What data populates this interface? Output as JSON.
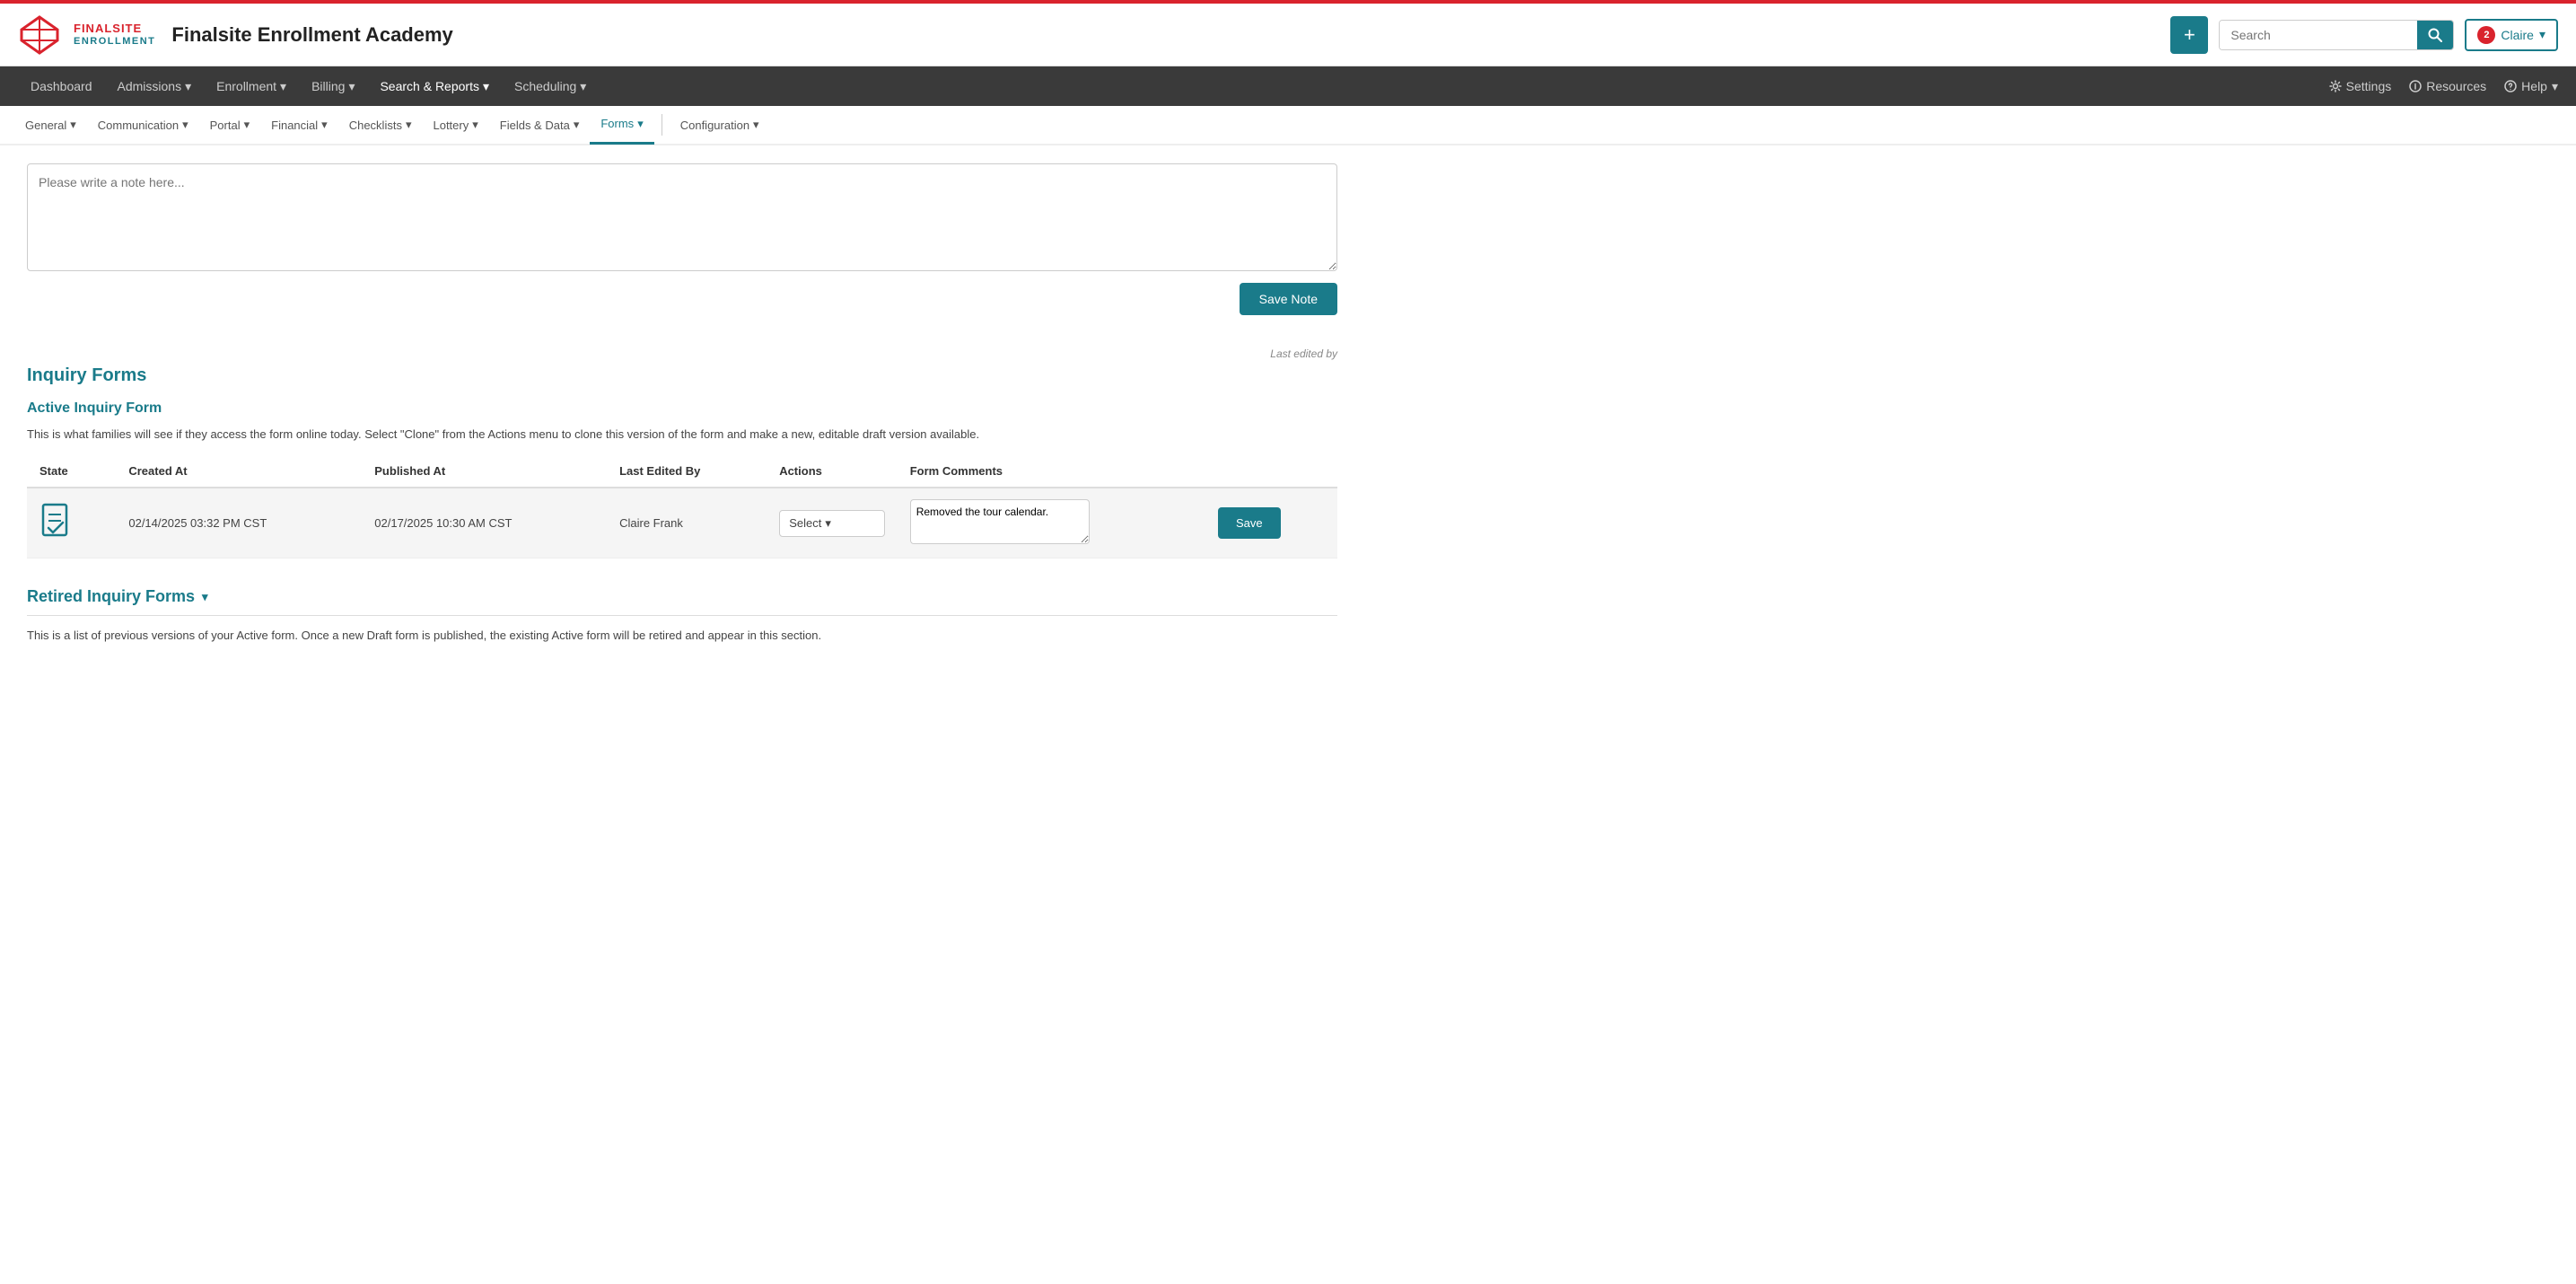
{
  "topbar": {
    "app_name": "Finalsite Enrollment Academy",
    "add_btn_label": "+",
    "search_placeholder": "Search",
    "notif_count": "2",
    "user_name": "Claire",
    "chevron": "▾"
  },
  "main_nav": {
    "items": [
      {
        "label": "Dashboard",
        "active": false
      },
      {
        "label": "Admissions",
        "active": false,
        "has_arrow": true
      },
      {
        "label": "Enrollment",
        "active": false,
        "has_arrow": true
      },
      {
        "label": "Billing",
        "active": false,
        "has_arrow": true
      },
      {
        "label": "Search & Reports",
        "active": false,
        "has_arrow": true
      },
      {
        "label": "Scheduling",
        "active": false,
        "has_arrow": true
      }
    ],
    "right_items": [
      {
        "icon": "gear-icon",
        "label": "Settings"
      },
      {
        "icon": "info-icon",
        "label": "Resources"
      },
      {
        "icon": "help-icon",
        "label": "Help",
        "has_arrow": true
      }
    ]
  },
  "sub_nav": {
    "items": [
      {
        "label": "General",
        "active": false,
        "has_arrow": true
      },
      {
        "label": "Communication",
        "active": false,
        "has_arrow": true
      },
      {
        "label": "Portal",
        "active": false,
        "has_arrow": true
      },
      {
        "label": "Financial",
        "active": false,
        "has_arrow": true
      },
      {
        "label": "Checklists",
        "active": false,
        "has_arrow": true
      },
      {
        "label": "Lottery",
        "active": false,
        "has_arrow": true
      },
      {
        "label": "Fields & Data",
        "active": false,
        "has_arrow": true
      },
      {
        "label": "Forms",
        "active": true,
        "has_arrow": true
      },
      {
        "label": "Configuration",
        "active": false,
        "has_arrow": true
      }
    ]
  },
  "note_area": {
    "placeholder": "Please write a note here...",
    "save_btn": "Save Note"
  },
  "inquiry_forms": {
    "section_title": "Inquiry Forms",
    "last_edited_label": "Last edited by",
    "active_section_title": "Active Inquiry Form",
    "description": "This is what families will see if they access the form online today. Select \"Clone\" from the Actions menu to clone this version of the form and make a new, editable draft version available.",
    "table_columns": {
      "state": "State",
      "created_at": "Created At",
      "published_at": "Published At",
      "last_edited_by": "Last Edited By",
      "actions": "Actions",
      "form_comments": "Form Comments"
    },
    "table_rows": [
      {
        "icon": "form-check-icon",
        "created_at": "02/14/2025 03:32 PM CST",
        "published_at": "02/17/2025 10:30 AM CST",
        "last_edited_by": "Claire Frank",
        "actions_label": "Select",
        "form_comment": "Removed the tour calendar.",
        "save_btn": "Save"
      }
    ]
  },
  "retired_section": {
    "title": "Retired Inquiry Forms",
    "chevron": "▾",
    "description": "This is a list of previous versions of your Active form. Once a new Draft form is published, the existing Active form will be retired and appear in this section."
  }
}
